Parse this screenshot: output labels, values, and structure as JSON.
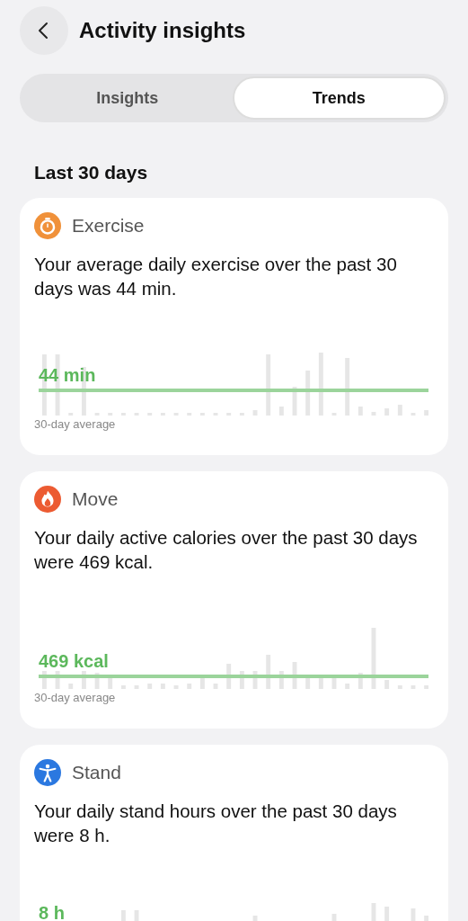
{
  "header": {
    "title": "Activity insights"
  },
  "tabs": [
    {
      "label": "Insights",
      "selected": false
    },
    {
      "label": "Trends",
      "selected": true
    }
  ],
  "section_title": "Last 30 days",
  "cards": [
    {
      "kind": "exercise",
      "title": "Exercise",
      "text": "Your average daily exercise over the past 30 days was 44 min.",
      "average": "44 min",
      "caption": "30-day average"
    },
    {
      "kind": "move",
      "title": "Move",
      "text": "Your daily active calories over the past 30 days were 469 kcal.",
      "average": "469 kcal",
      "caption": "30-day average"
    },
    {
      "kind": "stand",
      "title": "Stand",
      "text": "Your daily stand hours over the past 30 days were 8 h.",
      "average": "8 h"
    }
  ]
}
